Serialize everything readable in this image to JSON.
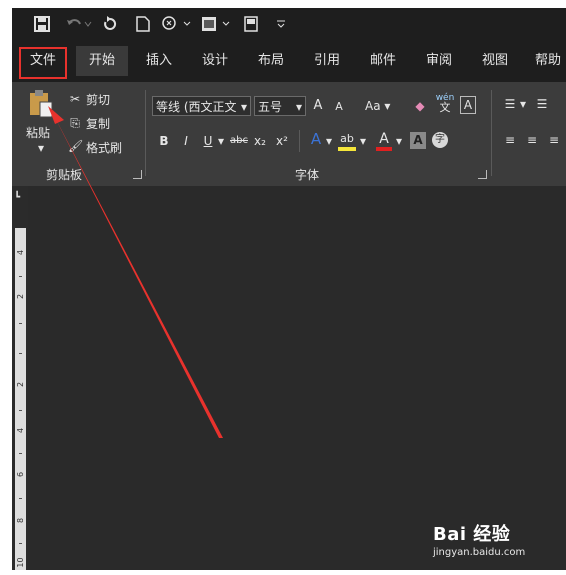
{
  "tabs": [
    {
      "label": "文件"
    },
    {
      "label": "开始"
    },
    {
      "label": "插入"
    },
    {
      "label": "设计"
    },
    {
      "label": "布局"
    },
    {
      "label": "引用"
    },
    {
      "label": "邮件"
    },
    {
      "label": "审阅"
    },
    {
      "label": "视图"
    },
    {
      "label": "帮助"
    }
  ],
  "clipboard": {
    "paste_label": "粘贴",
    "cut_label": "剪切",
    "copy_label": "复制",
    "format_painter_label": "格式刷",
    "group_label": "剪贴板"
  },
  "font": {
    "font_name": "等线 (西文正文",
    "font_size": "五号",
    "change_case": "Aa",
    "phonetic_top": "wén",
    "phonetic_bottom": "文",
    "border_char": "A",
    "enclose_char": "字",
    "bold": "B",
    "italic": "I",
    "underline": "U",
    "strike": "abc",
    "subscript": "x₂",
    "superscript": "x²",
    "text_effect": "A",
    "highlight": "ab",
    "font_color": "A",
    "shading_char": "A",
    "grow": "A",
    "shrink": "A",
    "group_label": "字体"
  },
  "ruler": [
    "4",
    "2",
    "2",
    "4",
    "6",
    "8",
    "10"
  ],
  "watermark": {
    "brand": "Bai 经验",
    "url": "jingyan.baidu.com"
  },
  "colors": {
    "annotation_red": "#e8322d",
    "tab_bar": "#1e1e1e",
    "ribbon": "#3c3c3c",
    "document": "#2a2a2a"
  },
  "icons": [
    "save-icon",
    "undo-icon",
    "redo-icon",
    "new-document-icon",
    "touch-mode-icon",
    "print-preview-icon",
    "view-icon",
    "customize-toolbar-icon"
  ]
}
